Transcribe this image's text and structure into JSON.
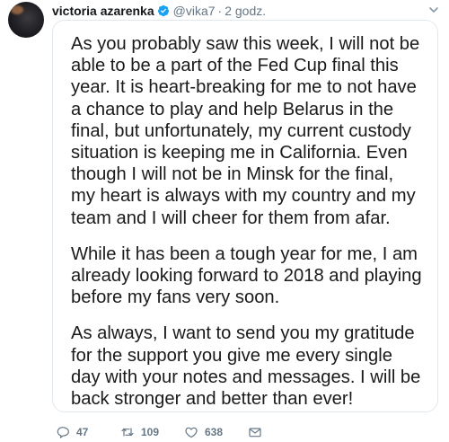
{
  "tweet": {
    "author_name": "victoria azarenka",
    "handle": "@vika7",
    "separator": "·",
    "time": "2 godz.",
    "image_paragraphs": [
      "As you probably saw this week, I will not be\nable to be a part of the Fed Cup final this\nyear.  It is heart-breaking for me to not have\na chance to play and help Belarus in the\nfinal, but unfortunately, my current custody\nsituation is keeping me in California.  Even\nthough I will not be in Minsk for the final,\nmy heart is always with my country and my\nteam and I will cheer for them from afar.",
      "While it has been a tough year for me, I am\nalready looking forward to 2018 and playing\nbefore my fans very soon.",
      "As always, I want to send you my gratitude\nfor the support you give me every single\nday with your notes and messages. I will be\nback stronger and better than ever!"
    ]
  },
  "actions": {
    "replies": "47",
    "retweets": "109",
    "likes": "638"
  },
  "icons": {
    "verified": "verified-badge-icon",
    "caret": "chevron-down-icon",
    "reply": "reply-icon",
    "retweet": "retweet-icon",
    "like": "heart-icon",
    "dm": "envelope-icon"
  },
  "colors": {
    "verified": "#1da1f2",
    "meta": "#657786",
    "border": "#e1e8ed"
  }
}
